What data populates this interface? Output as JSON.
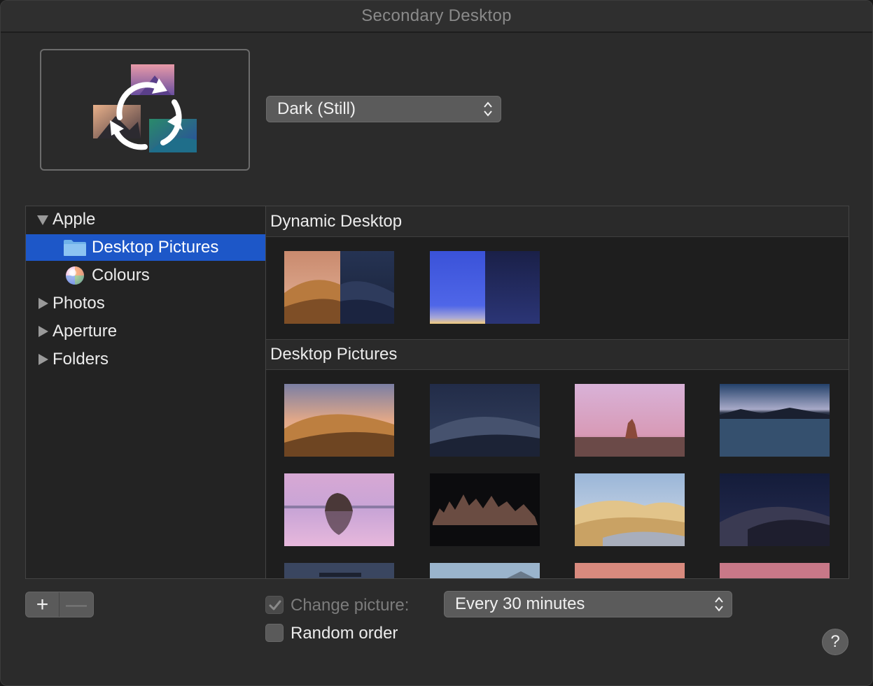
{
  "window": {
    "title": "Secondary Desktop"
  },
  "style_popup": {
    "value": "Dark (Still)"
  },
  "sources": [
    {
      "label": "Apple",
      "kind": "group",
      "state": "expanded"
    },
    {
      "label": "Desktop Pictures",
      "kind": "folder",
      "selected": true
    },
    {
      "label": "Colours",
      "kind": "colours"
    },
    {
      "label": "Photos",
      "kind": "group",
      "state": "collapsed"
    },
    {
      "label": "Aperture",
      "kind": "group",
      "state": "collapsed"
    },
    {
      "label": "Folders",
      "kind": "group",
      "state": "collapsed"
    }
  ],
  "sections": [
    {
      "title": "Dynamic Desktop"
    },
    {
      "title": "Desktop Pictures"
    }
  ],
  "dynamic_thumbnails": [
    "mojave-dynamic-thumbnail",
    "solar-gradients-thumbnail"
  ],
  "picture_thumbnails": [
    "mojave-day-thumbnail",
    "mojave-night-thumbnail",
    "desert-rock-pink-thumbnail",
    "lake-dusk-thumbnail",
    "lake-rock-reflection-thumbnail",
    "tufa-night-thumbnail",
    "sand-dunes-day-thumbnail",
    "dune-night-thumbnail",
    "partial-thumbnail-1",
    "partial-thumbnail-2",
    "partial-thumbnail-3",
    "partial-thumbnail-4"
  ],
  "bottom": {
    "add_label": "+",
    "remove_label": "—",
    "change_picture_label": "Change picture:",
    "change_picture_checked": true,
    "change_picture_enabled": false,
    "interval": "Every 30 minutes",
    "random_order_label": "Random order",
    "random_order_checked": false,
    "help_label": "?"
  },
  "colors": {
    "accent": "#1d57c8",
    "background": "#2b2b2b"
  }
}
